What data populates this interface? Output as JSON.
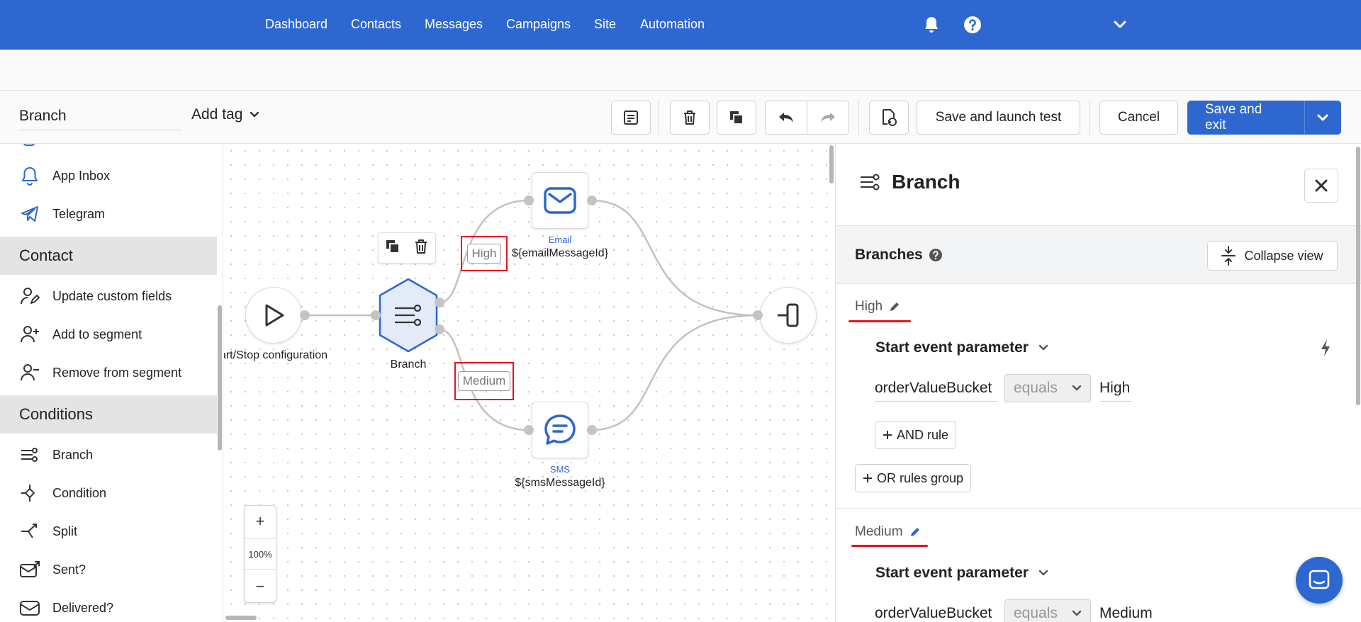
{
  "nav": {
    "items": [
      "Dashboard",
      "Contacts",
      "Messages",
      "Campaigns",
      "Site",
      "Automation"
    ],
    "icons": [
      "bell-icon",
      "help-icon",
      "chevron-down-icon"
    ]
  },
  "toolbar": {
    "workflow_name": "Branch",
    "add_tag": "Add tag",
    "save_launch_test": "Save and launch test",
    "cancel": "Cancel",
    "save_exit": "Save and exit"
  },
  "sidebar": {
    "items_top": [
      "App Inbox",
      "Telegram"
    ],
    "group_contact": "Contact",
    "items_contact": [
      "Update custom fields",
      "Add to segment",
      "Remove from segment"
    ],
    "group_conditions": "Conditions",
    "items_conditions": [
      "Branch",
      "Condition",
      "Split",
      "Sent?",
      "Delivered?"
    ]
  },
  "canvas": {
    "start_label": "art/Stop configuration",
    "branch_label": "Branch",
    "email_type": "Email",
    "email_label": "${emailMessageId}",
    "sms_type": "SMS",
    "sms_label": "${smsMessageId}",
    "edge_high": "High",
    "edge_medium": "Medium",
    "zoom_in": "+",
    "zoom_level": "100%",
    "zoom_out": "−"
  },
  "panel": {
    "title": "Branch",
    "branches_title": "Branches",
    "collapse": "Collapse view",
    "branches": [
      {
        "name": "High",
        "condition": "Start event parameter",
        "field": "orderValueBucket",
        "operator": "equals",
        "value": "High",
        "and_rule": "AND rule",
        "or_group": "OR rules group"
      },
      {
        "name": "Medium",
        "condition": "Start event parameter",
        "field": "orderValueBucket",
        "operator": "equals",
        "value": "Medium"
      }
    ]
  },
  "colors": {
    "brand": "#2d67cf",
    "highlight": "#e5141f"
  }
}
